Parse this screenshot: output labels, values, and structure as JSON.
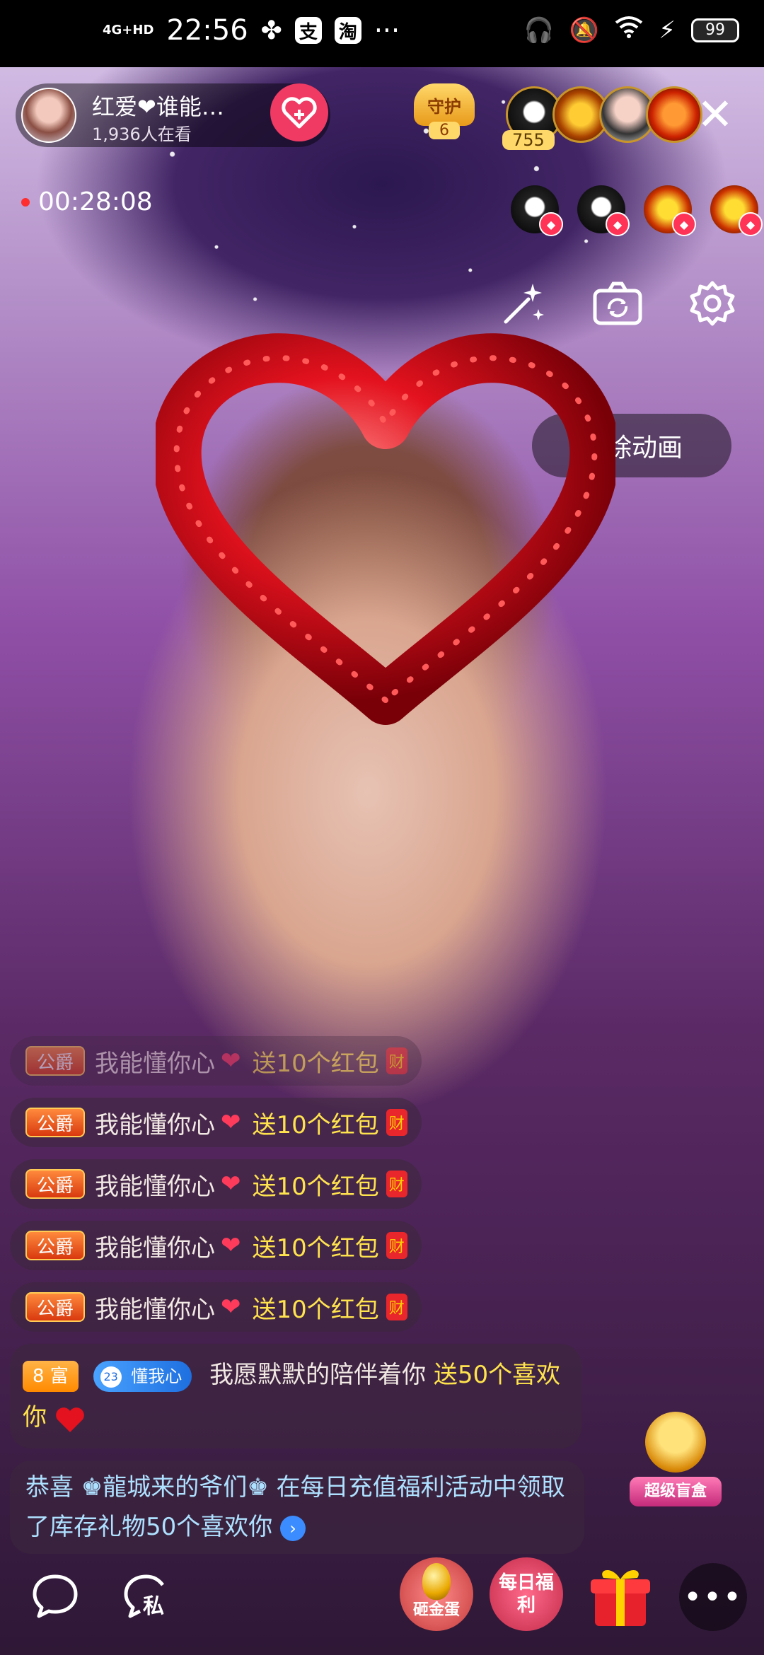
{
  "status_bar": {
    "network": "4G+HD",
    "time": "22:56",
    "app_icons": [
      "支",
      "淘"
    ],
    "more": "···",
    "battery": "99"
  },
  "host": {
    "name": "红爱❤谁能…",
    "viewers": "1,936人在看"
  },
  "guard_badge": {
    "label": "守护",
    "count": "6"
  },
  "top_viewers_count": "755",
  "live_timer": "00:28:08",
  "clear_animation": "清除动画",
  "chat": {
    "gift_messages": [
      {
        "rank": "公爵",
        "user": "我能懂你心",
        "heart": "❤",
        "gift": "送10个红包",
        "packet": "财"
      },
      {
        "rank": "公爵",
        "user": "我能懂你心",
        "heart": "❤",
        "gift": "送10个红包",
        "packet": "财"
      },
      {
        "rank": "公爵",
        "user": "我能懂你心",
        "heart": "❤",
        "gift": "送10个红包",
        "packet": "财"
      },
      {
        "rank": "公爵",
        "user": "我能懂你心",
        "heart": "❤",
        "gift": "送10个红包",
        "packet": "财"
      },
      {
        "rank": "公爵",
        "user": "我能懂你心",
        "heart": "❤",
        "gift": "送10个红包",
        "packet": "财"
      }
    ],
    "rich_message": {
      "rich_level": "8 富",
      "fan_level": "23",
      "fan_badge": "懂我心",
      "text": "我愿默默的陪伴着你",
      "gift": "送50个喜欢你"
    },
    "system_message": {
      "text": "恭喜 ♚龍城来的爷们♚ 在每日充值福利活动中领取了库存礼物50个喜欢你"
    }
  },
  "mystery_box_label": "超级盲盒",
  "bottom_bar": {
    "private_label": "私",
    "golden_egg_label": "砸金蛋",
    "daily_welfare_label": "每日福利"
  },
  "colors": {
    "follow": "#f03a64",
    "gift_text": "#ffe34d",
    "system_text": "#aee0ff",
    "rank_badge": "#d9390f"
  }
}
